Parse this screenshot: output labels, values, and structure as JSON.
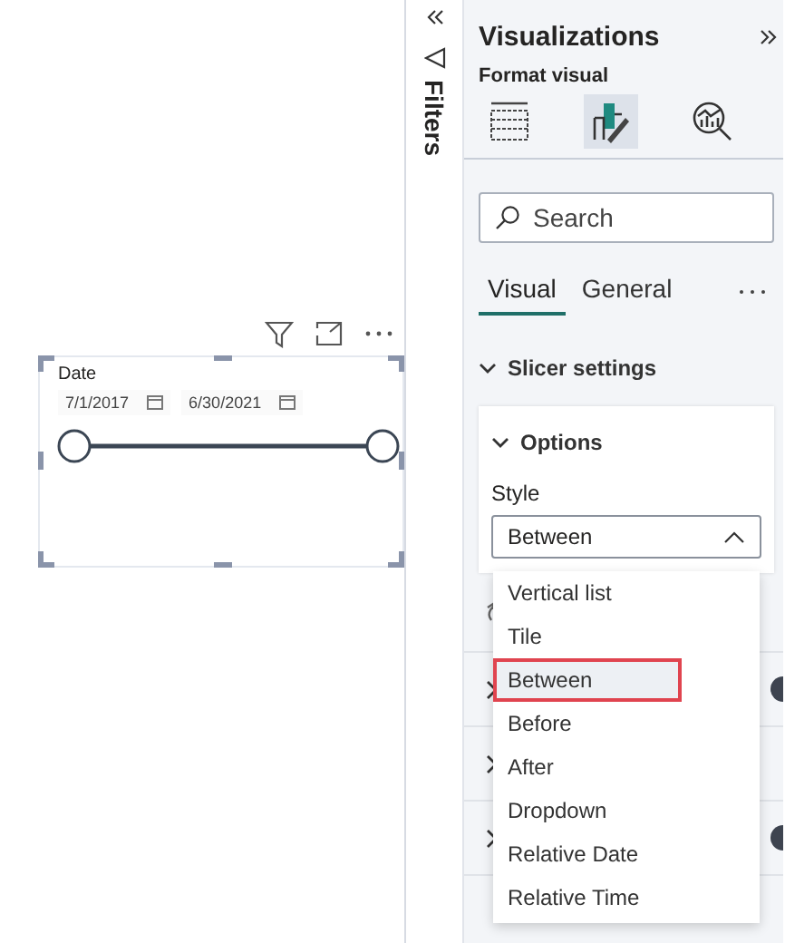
{
  "canvas": {
    "slicer": {
      "title": "Date",
      "start_date": "7/1/2017",
      "end_date": "6/30/2021",
      "slider": {
        "level": 1
      }
    }
  },
  "filters_pane": {
    "label": "Filters"
  },
  "visualizations": {
    "title": "Visualizations",
    "section": "Format visual",
    "view_tabs": [
      {
        "kind": "build",
        "selected": false
      },
      {
        "kind": "format",
        "selected": true
      },
      {
        "kind": "analytics",
        "selected": false
      }
    ],
    "search": {
      "placeholder": "Search"
    },
    "tabs": [
      {
        "label": "Visual",
        "selected": true
      },
      {
        "label": "General",
        "selected": false
      }
    ],
    "group": {
      "label": "Slicer settings",
      "expanded": true
    },
    "card": {
      "label": "Options",
      "expanded": true,
      "field_label": "Style",
      "value": "Between",
      "open": true
    },
    "settings_rows": [
      {
        "kind": "reset"
      },
      {
        "kind": "toggle",
        "on": true
      },
      {
        "kind": "plain"
      },
      {
        "kind": "toggle",
        "on": true
      }
    ],
    "options": [
      {
        "label": "Vertical list",
        "selected": false,
        "outlined": false
      },
      {
        "label": "Tile",
        "selected": false,
        "outlined": false
      },
      {
        "label": "Between",
        "selected": true,
        "outlined": true
      },
      {
        "label": "Before",
        "selected": false,
        "outlined": false
      },
      {
        "label": "After",
        "selected": false,
        "outlined": false
      },
      {
        "label": "Dropdown",
        "selected": false,
        "outlined": false
      },
      {
        "label": "Relative Date",
        "selected": false,
        "outlined": false
      },
      {
        "label": "Relative Time",
        "selected": false,
        "outlined": false
      }
    ]
  }
}
